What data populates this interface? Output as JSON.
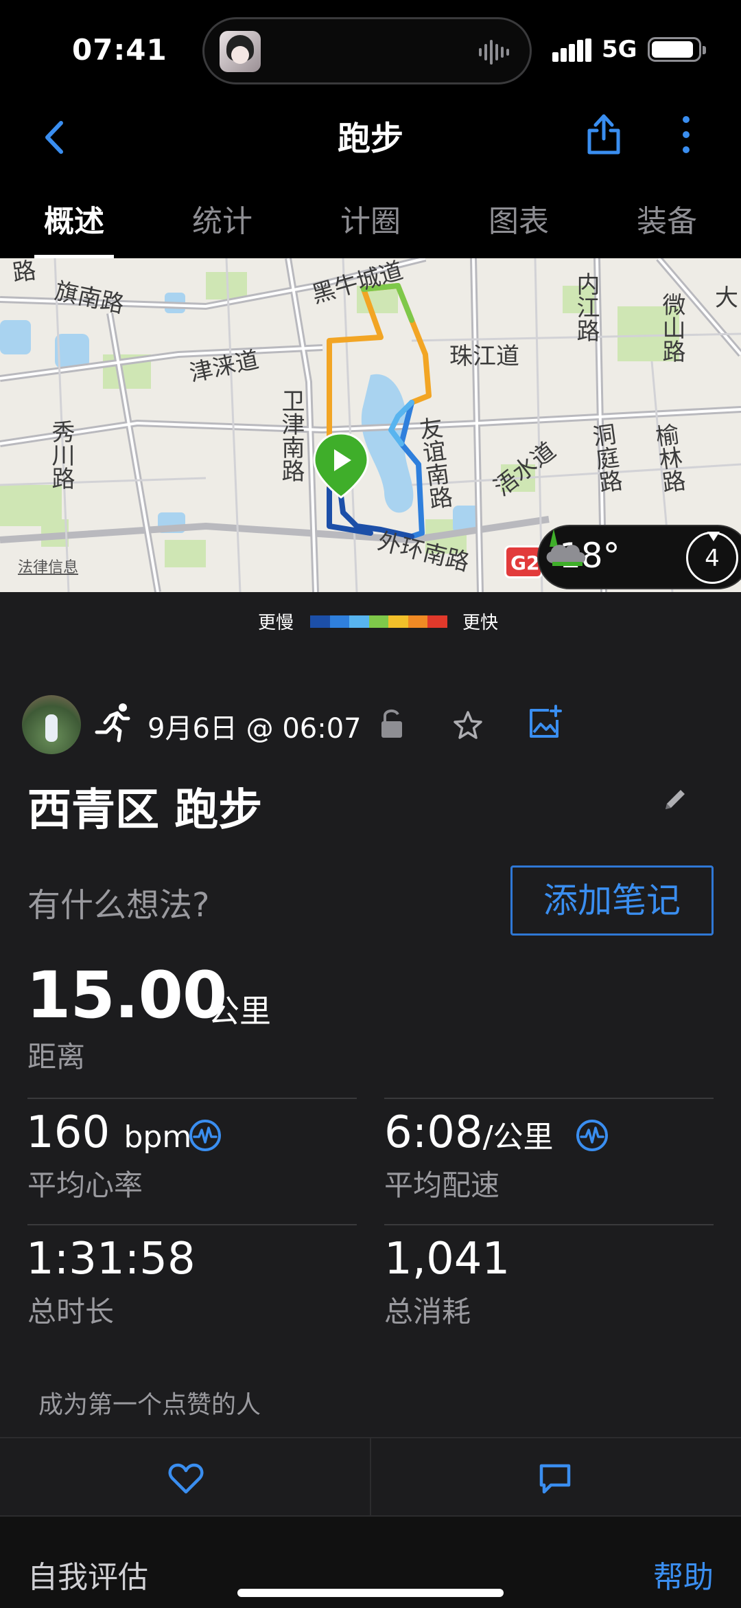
{
  "status_bar": {
    "time": "07:41",
    "network": "5G"
  },
  "nav": {
    "title": "跑步"
  },
  "tabs": [
    {
      "label": "概述",
      "active": true
    },
    {
      "label": "统计",
      "active": false
    },
    {
      "label": "计圈",
      "active": false
    },
    {
      "label": "图表",
      "active": false
    },
    {
      "label": "装备",
      "active": false
    }
  ],
  "map": {
    "labels": [
      "旗南路",
      "黑牛城道",
      "津涞道",
      "卫津南路",
      "珠江道",
      "内江路",
      "微山路",
      "秀川路",
      "友谊南路",
      "浯水道",
      "洞庭路",
      "榆林路",
      "外环南路",
      "大"
    ],
    "legal": "法律信息",
    "highway_badge": "G2",
    "weather": {
      "temperature": "18°",
      "wind_speed": "4"
    }
  },
  "legend": {
    "slower": "更慢",
    "faster": "更快",
    "colors": [
      "#1c4fa8",
      "#2f7fdc",
      "#58b4ef",
      "#7ec84a",
      "#f2c02a",
      "#f08a24",
      "#e0392b"
    ]
  },
  "activity": {
    "date": "9月6日 @ 06:07",
    "title": "西青区 跑步",
    "thoughts_placeholder": "有什么想法?",
    "add_note": "添加笔记",
    "distance": {
      "value": "15.00",
      "unit": "公里",
      "label": "距离"
    },
    "heart_rate": {
      "value": "160",
      "unit": "bpm",
      "label": "平均心率"
    },
    "pace": {
      "value": "6:08",
      "unit": "/公里",
      "label": "平均配速"
    },
    "duration": {
      "value": "1:31:58",
      "label": "总时长"
    },
    "calories": {
      "value": "1,041",
      "label": "总消耗"
    },
    "like_prompt": "成为第一个点赞的人"
  },
  "bottom": {
    "self_eval": "自我评估",
    "help": "帮助"
  },
  "colors": {
    "accent": "#3a8ef0",
    "background": "#1c1c1e"
  }
}
